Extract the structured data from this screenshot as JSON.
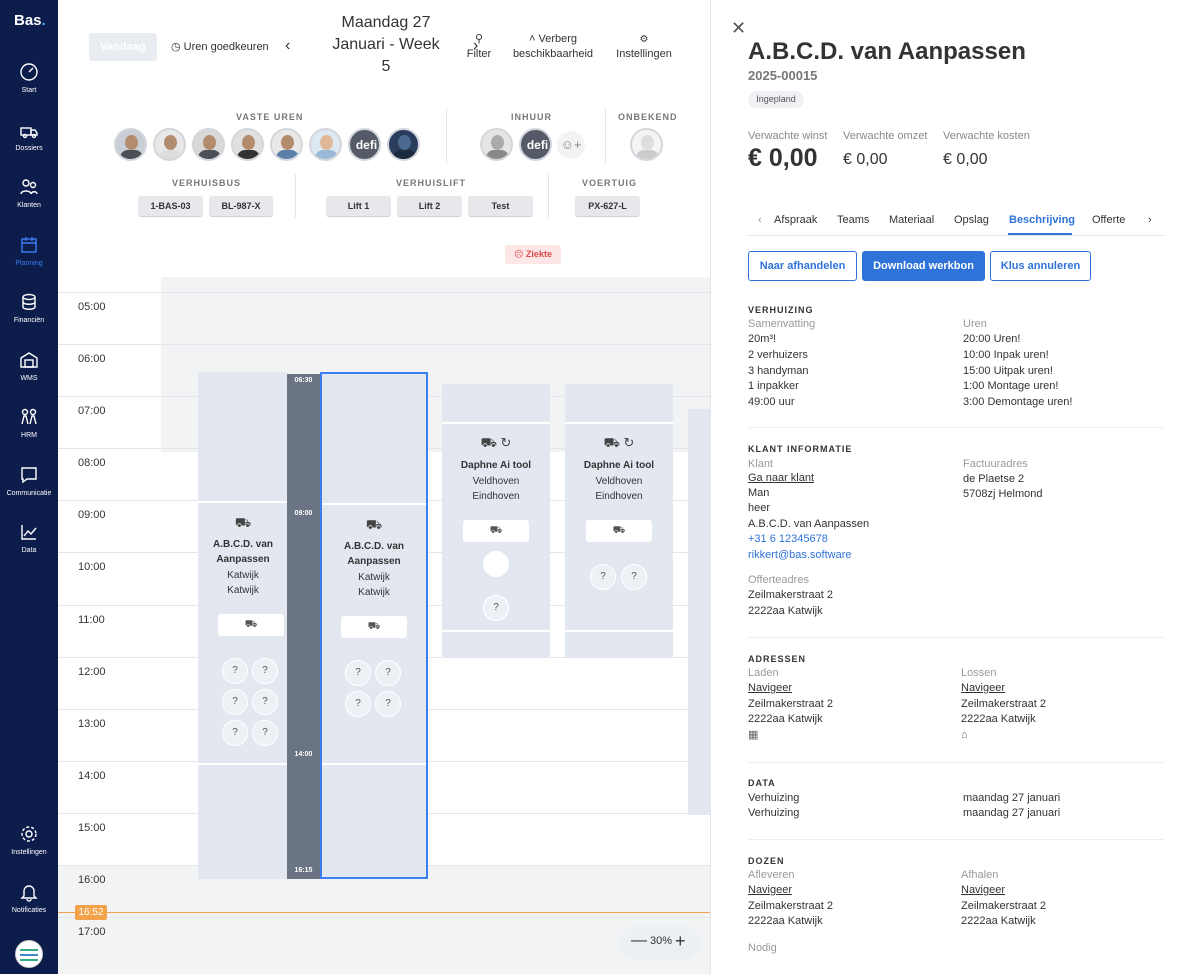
{
  "sidebar": {
    "logo": "Bas",
    "items": [
      {
        "label": "Start",
        "icon": "dashboard-icon"
      },
      {
        "label": "Dossiers",
        "icon": "truck-icon"
      },
      {
        "label": "Klanten",
        "icon": "users-icon"
      },
      {
        "label": "Planning",
        "icon": "calendar-icon"
      },
      {
        "label": "Financiën",
        "icon": "coins-icon"
      },
      {
        "label": "WMS",
        "icon": "warehouse-icon"
      },
      {
        "label": "HRM",
        "icon": "people-icon"
      },
      {
        "label": "Communicatie",
        "icon": "chat-icon"
      },
      {
        "label": "Data",
        "icon": "chart-icon"
      },
      {
        "label": "Instellingen",
        "icon": "gear-icon"
      },
      {
        "label": "Notificaties",
        "icon": "bell-icon"
      }
    ]
  },
  "toolbar": {
    "today": "Vandaag",
    "approve_hours": "Uren goedkeuren",
    "date_line1": "Maandag 27",
    "date_line2": "Januari - Week",
    "date_line3": "5",
    "filter": "Filter",
    "hide_line1": "Verberg",
    "hide_line2": "beschikbaarheid",
    "settings": "Instellingen"
  },
  "resources": {
    "fixed_hours": "VASTE UREN",
    "hire": "INHUUR",
    "unknown": "ONBEKEND",
    "van_label": "VERHUISBUS",
    "lift_label": "VERHUISLIFT",
    "vehicle_label": "VOERTUIG",
    "vans": [
      "1-BAS-03",
      "BL-987-X"
    ],
    "lifts": [
      "Lift 1",
      "Lift 2",
      "Test"
    ],
    "vehicles": [
      "PX-627-L"
    ],
    "dark_avatar_text": "defi",
    "ziekte": "Ziekte"
  },
  "calendar": {
    "hours": [
      "05:00",
      "06:00",
      "07:00",
      "08:00",
      "09:00",
      "10:00",
      "11:00",
      "12:00",
      "13:00",
      "14:00",
      "15:00",
      "16:00",
      "17:00"
    ],
    "time_bar": {
      "start": "06:30",
      "mid": "09:00",
      "end_a": "14:00",
      "end_b": "16:15"
    },
    "events": [
      {
        "title_1": "A.B.C.D. van",
        "title_2": "Aanpassen",
        "city_1": "Katwijk",
        "city_2": "Katwijk"
      },
      {
        "title_1": "A.B.C.D. van",
        "title_2": "Aanpassen",
        "city_1": "Katwijk",
        "city_2": "Katwijk"
      },
      {
        "title_1": "Daphne Ai tool",
        "city_1": "Veldhoven",
        "city_2": "Eindhoven"
      },
      {
        "title_1": "Daphne Ai tool",
        "city_1": "Veldhoven",
        "city_2": "Eindhoven"
      }
    ],
    "now": "16:52",
    "zoom": "30%"
  },
  "panel": {
    "title": "A.B.C.D. van Aanpassen",
    "number": "2025-00015",
    "status": "Ingepland",
    "kpis": {
      "profit_label": "Verwachte winst",
      "profit": "€ 0,00",
      "revenue_label": "Verwachte omzet",
      "revenue": "€ 0,00",
      "cost_label": "Verwachte kosten",
      "cost": "€ 0,00"
    },
    "tabs": [
      "Afspraak",
      "Teams",
      "Materiaal",
      "Opslag",
      "Beschrijving",
      "Offerte"
    ],
    "buttons": {
      "complete": "Naar afhandelen",
      "download": "Download werkbon",
      "cancel": "Klus annuleren"
    },
    "move": {
      "title": "VERHUIZING",
      "summary_label": "Samenvatting",
      "summary": [
        "20m³!",
        "2 verhuizers",
        "3 handyman",
        "1 inpakker",
        "49:00 uur"
      ],
      "hours_label": "Uren",
      "hours": [
        "20:00 Uren!",
        "10:00 Inpak uren!",
        "15:00 Uitpak uren!",
        "1:00 Montage uren!",
        "3:00 Demontage uren!"
      ]
    },
    "client": {
      "title": "KLANT INFORMATIE",
      "client_label": "Klant",
      "goto": "Ga naar klant",
      "gender": "Man",
      "salutation": "heer",
      "name": "A.B.C.D. van Aanpassen",
      "phone": "+31 6 12345678",
      "email": "rikkert@bas.software",
      "invoice_label": "Factuuradres",
      "invoice_1": "de Plaetse 2",
      "invoice_2": "5708zj Helmond",
      "quote_label": "Offerteadres",
      "quote_1": "Zeilmakerstraat 2",
      "quote_2": "2222aa Katwijk"
    },
    "addresses": {
      "title": "ADRESSEN",
      "load_label": "Laden",
      "unload_label": "Lossen",
      "navigate": "Navigeer",
      "street": "Zeilmakerstraat 2",
      "city": "2222aa Katwijk"
    },
    "data": {
      "title": "DATA",
      "rows": [
        {
          "label": "Verhuizing",
          "value": "maandag 27 januari"
        },
        {
          "label": "Verhuizing",
          "value": "maandag 27 januari"
        }
      ]
    },
    "boxes": {
      "title": "DOZEN",
      "deliver_label": "Afleveren",
      "pickup_label": "Afhalen",
      "navigate": "Navigeer",
      "street": "Zeilmakerstraat 2",
      "city": "2222aa Katwijk",
      "needed": "Nodig"
    }
  }
}
